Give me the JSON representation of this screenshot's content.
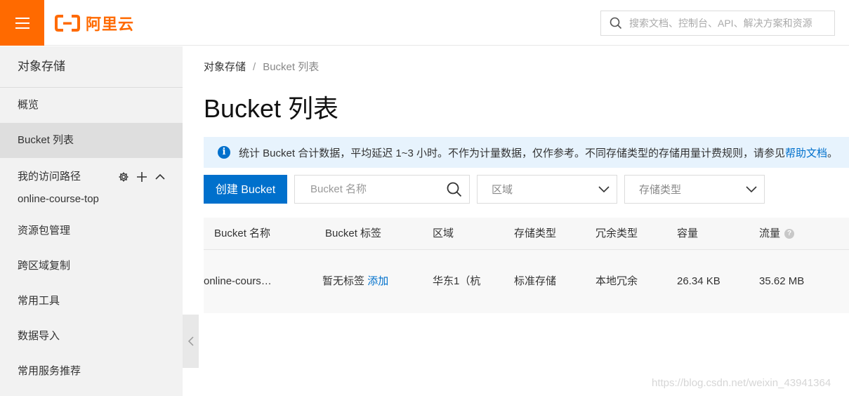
{
  "header": {
    "logo_text": "阿里云",
    "search_placeholder": "搜索文档、控制台、API、解决方案和资源",
    "brand_color": "#ff6a00"
  },
  "sidebar": {
    "title": "对象存储",
    "items": [
      {
        "label": "概览",
        "active": false
      },
      {
        "label": "Bucket 列表",
        "active": true
      },
      {
        "label": "online-course-top",
        "active": false
      },
      {
        "label": "资源包管理",
        "active": false
      },
      {
        "label": "跨区域复制",
        "active": false
      },
      {
        "label": "常用工具",
        "active": false
      },
      {
        "label": "数据导入",
        "active": false
      },
      {
        "label": "常用服务推荐",
        "active": false
      }
    ],
    "path_section": "我的访问路径"
  },
  "breadcrumb": {
    "root": "对象存储",
    "separator": "/",
    "current": "Bucket 列表"
  },
  "page_title": "Bucket 列表",
  "notice": {
    "text": "统计 Bucket 合计数据，平均延迟 1~3 小时。不作为计量数据，仅作参考。不同存储类型的存储用量计费规则，请参见",
    "link": "帮助文档",
    "tail": "。"
  },
  "toolbar": {
    "create_label": "创建 Bucket",
    "name_placeholder": "Bucket 名称",
    "region_label": "区域",
    "storage_label": "存储类型"
  },
  "table": {
    "headers": [
      "Bucket 名称",
      "Bucket 标签",
      "区域",
      "存储类型",
      "冗余类型",
      "容量",
      "流量"
    ],
    "rows": [
      {
        "name": "online-cours…",
        "tag_text": "暂无标签",
        "tag_link": "添加",
        "region": "华东1（杭",
        "storage": "标准存储",
        "redundancy": "本地冗余",
        "capacity": "26.34 KB",
        "traffic": "35.62 MB"
      }
    ]
  },
  "watermark": "https://blog.csdn.net/weixin_43941364",
  "accent_color": "#0070cc"
}
